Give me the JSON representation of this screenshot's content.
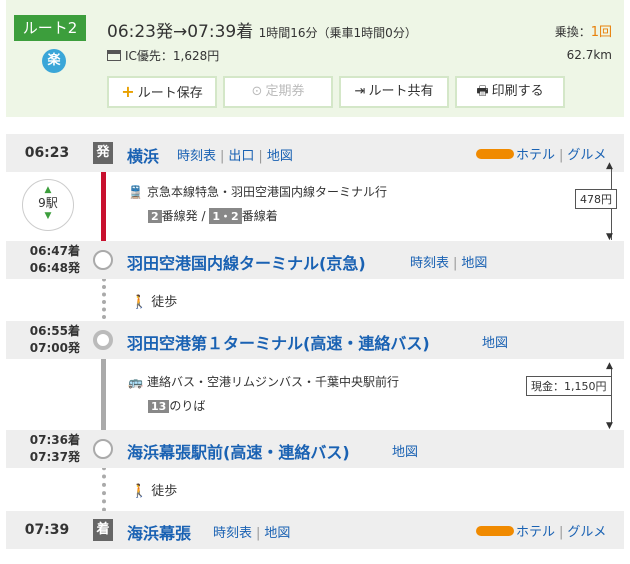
{
  "header": {
    "route_label": "ルート2",
    "raku_label": "楽",
    "dep_arr": "06:23発→07:39着",
    "duration": "1時間16分（乗車1時間0分）",
    "fare": "IC優先：1,628円",
    "transfer_label": "乗換：",
    "transfer_count": "1回",
    "distance": "62.7km",
    "buttons": {
      "save": "ルート保存",
      "pass": "定期券",
      "share": "ルート共有",
      "print": "印刷する"
    }
  },
  "stations": [
    {
      "time": "06:23",
      "tag": "発",
      "name": "横浜",
      "links": [
        "時刻表",
        "出口",
        "地図"
      ],
      "hotel": "ホテル",
      "gourmet": "グルメ"
    },
    {
      "time_arr": "06:47着",
      "time_dep": "06:48発",
      "name": "羽田空港国内線ターミナル(京急)",
      "links": [
        "時刻表",
        "地図"
      ]
    },
    {
      "time_arr": "06:55着",
      "time_dep": "07:00発",
      "name": "羽田空港第１ターミナル(高速・連絡バス)",
      "links": [
        "地図"
      ]
    },
    {
      "time_arr": "07:36着",
      "time_dep": "07:37発",
      "name": "海浜幕張駅前(高速・連絡バス)",
      "links": [
        "地図"
      ]
    },
    {
      "time": "07:39",
      "tag": "着",
      "name": "海浜幕張",
      "links": [
        "時刻表",
        "地図"
      ],
      "hotel": "ホテル",
      "gourmet": "グルメ"
    }
  ],
  "segments": {
    "train": {
      "stops": "9駅",
      "line": "京急本線特急・羽田空港国内線ターミナル行",
      "platform_dep_num": "2",
      "platform_dep_text": "番線発",
      "platform_slash": "/",
      "platform_arr_num": "1・2",
      "platform_arr_text": "番線着",
      "price": "478円"
    },
    "walk1": "徒歩",
    "bus": {
      "line": "連絡バス・空港リムジンバス・千葉中央駅前行",
      "stop_num": "13",
      "stop_text": "のりば",
      "price": "現金：1,150円"
    },
    "walk2": "徒歩"
  },
  "colors": {
    "accent_green": "#3c9e3c",
    "rail_red": "#c8102e",
    "link_blue": "#1a62b3",
    "orange": "#e8810b"
  }
}
